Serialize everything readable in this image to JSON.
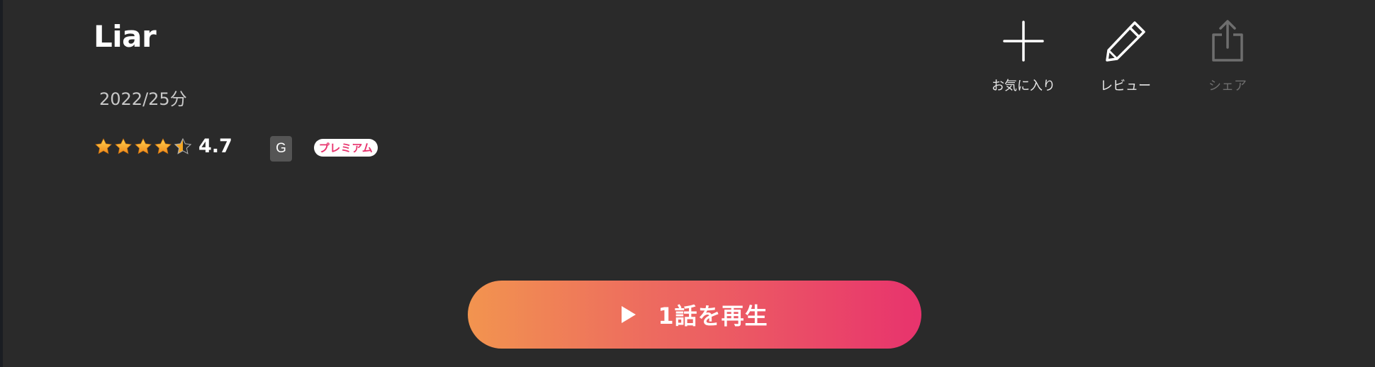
{
  "title": "Liar",
  "meta": {
    "year_duration": "2022/25分"
  },
  "rating": {
    "value": "4.7",
    "stars": 4.5,
    "star_color": "#f5a623"
  },
  "badges": {
    "age": "G",
    "premium": "プレミアム"
  },
  "actions": {
    "favorite": {
      "label": "お気に入り",
      "icon": "plus-icon"
    },
    "review": {
      "label": "レビュー",
      "icon": "pencil-icon"
    },
    "share": {
      "label": "シェア",
      "icon": "share-icon",
      "disabled": true
    }
  },
  "play": {
    "label": "1話を再生",
    "icon": "play-icon",
    "gradient": [
      "#f2944f",
      "#e8336d"
    ]
  },
  "colors": {
    "background": "#2a2a2a",
    "accent": "#e8336d"
  }
}
